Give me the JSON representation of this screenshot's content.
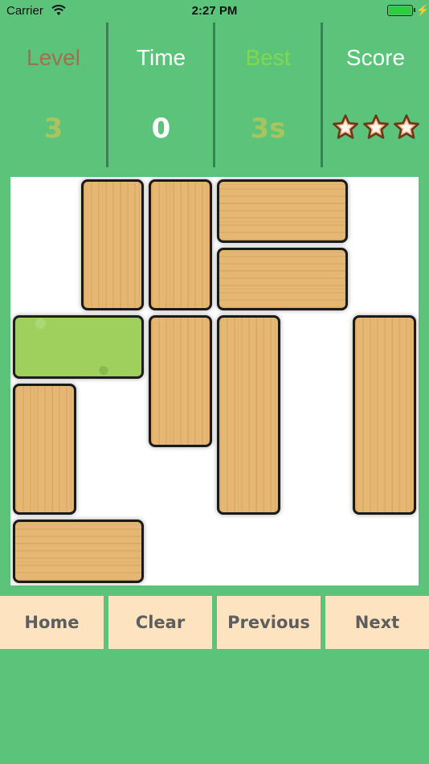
{
  "status_bar": {
    "carrier": "Carrier",
    "time": "2:27 PM"
  },
  "stats": {
    "level": {
      "label": "Level",
      "value": "3",
      "label_color": "#a0704e",
      "value_color": "#a8c45e"
    },
    "time": {
      "label": "Time",
      "value": "0",
      "label_color": "#ffffff",
      "value_color": "#ffffff"
    },
    "best": {
      "label": "Best",
      "value": "3s",
      "label_color": "#7fd84f",
      "value_color": "#a8c45e"
    },
    "score": {
      "label": "Score",
      "stars": 3,
      "stars_max": 3,
      "label_color": "#ffffff"
    }
  },
  "board": {
    "grid_size": 6,
    "blocks": [
      {
        "id": "v1",
        "type": "vertical",
        "col": 1,
        "row": 0,
        "w": 1,
        "h": 2
      },
      {
        "id": "v2",
        "type": "vertical",
        "col": 2,
        "row": 0,
        "w": 1,
        "h": 2
      },
      {
        "id": "h1",
        "type": "horizontal",
        "col": 3,
        "row": 0,
        "w": 2,
        "h": 1
      },
      {
        "id": "h2",
        "type": "horizontal",
        "col": 3,
        "row": 1,
        "w": 2,
        "h": 1
      },
      {
        "id": "t",
        "type": "target",
        "col": 0,
        "row": 2,
        "w": 2,
        "h": 1
      },
      {
        "id": "v3",
        "type": "vertical",
        "col": 2,
        "row": 2,
        "w": 1,
        "h": 2
      },
      {
        "id": "v4",
        "type": "vertical",
        "col": 3,
        "row": 2,
        "w": 1,
        "h": 3
      },
      {
        "id": "v5",
        "type": "vertical",
        "col": 5,
        "row": 2,
        "w": 1,
        "h": 3
      },
      {
        "id": "v6",
        "type": "vertical",
        "col": 0,
        "row": 3,
        "w": 1,
        "h": 2
      },
      {
        "id": "h3",
        "type": "horizontal",
        "col": 0,
        "row": 5,
        "w": 2,
        "h": 1
      }
    ]
  },
  "buttons": {
    "home": "Home",
    "clear": "Clear",
    "previous": "Previous",
    "next": "Next"
  },
  "colors": {
    "background": "#5cc47a",
    "button_bg": "#fde3bf",
    "button_text": "#5e5e5e",
    "wood": "#e5b772",
    "target": "#9fd05e"
  }
}
